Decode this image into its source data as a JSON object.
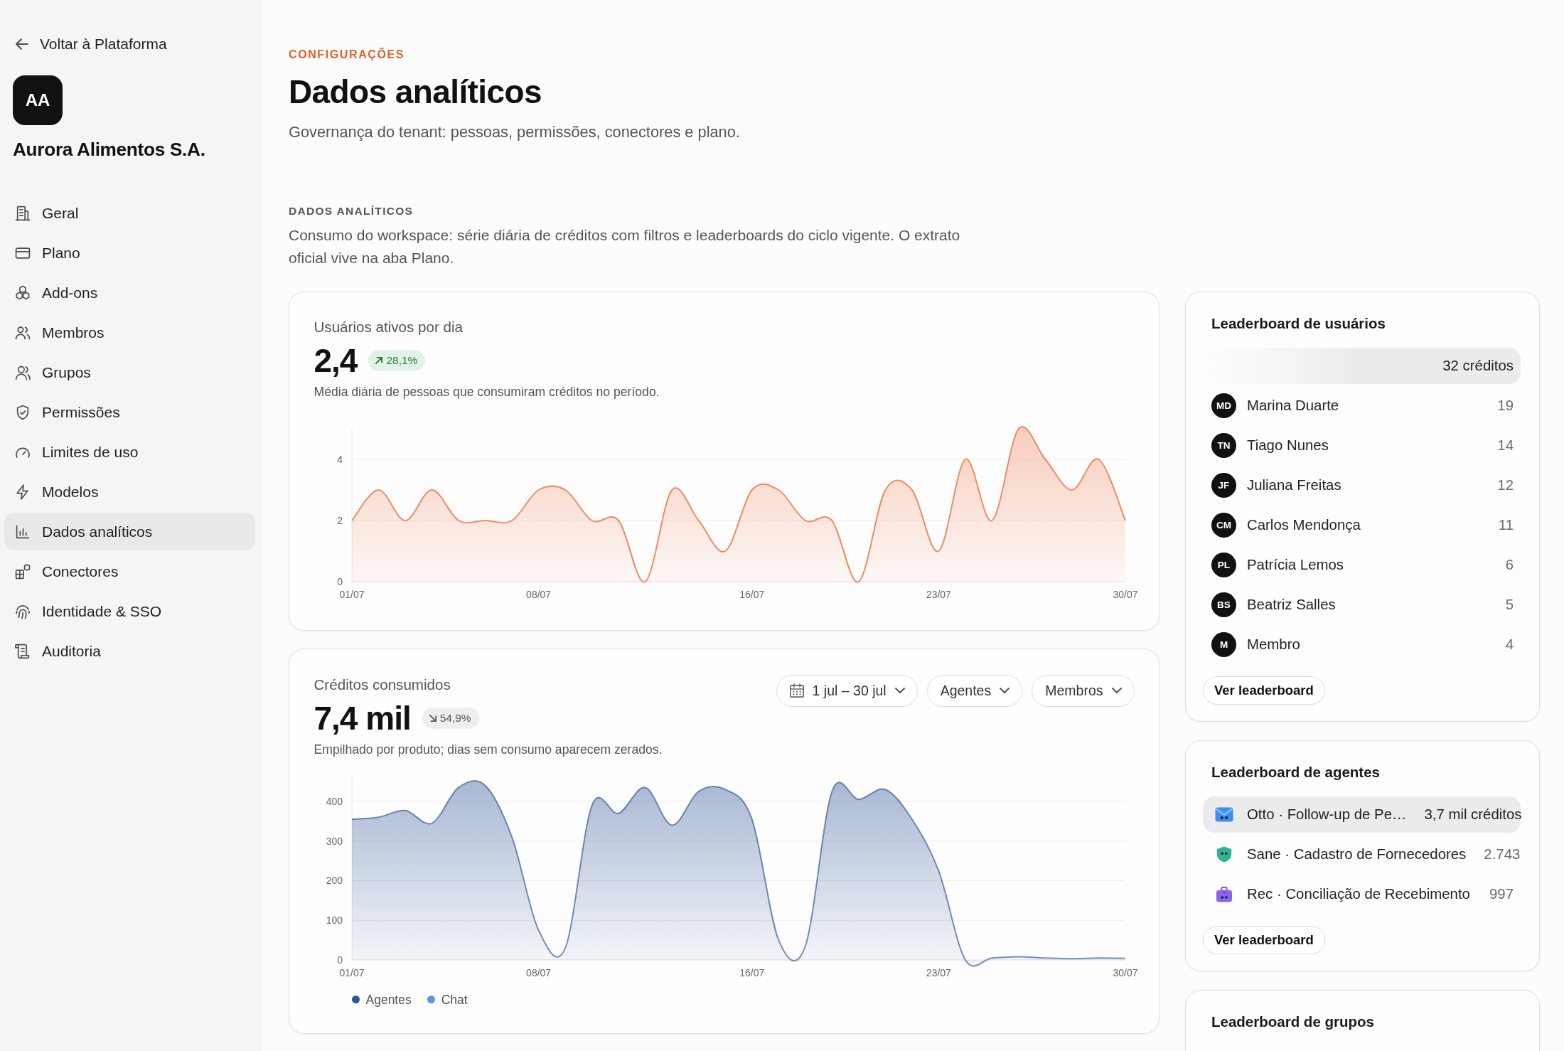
{
  "sidebar": {
    "back_link": "Voltar à Plataforma",
    "org": {
      "initials": "AA",
      "name": "Aurora Alimentos S.A."
    },
    "items": [
      {
        "label": "Geral",
        "kind": "building",
        "selected": false
      },
      {
        "label": "Plano",
        "kind": "card",
        "selected": false
      },
      {
        "label": "Add-ons",
        "kind": "cubes",
        "selected": false
      },
      {
        "label": "Membros",
        "kind": "people",
        "selected": false
      },
      {
        "label": "Grupos",
        "kind": "group",
        "selected": false
      },
      {
        "label": "Permissões",
        "kind": "shield",
        "selected": false
      },
      {
        "label": "Limites de uso",
        "kind": "gauge",
        "selected": false
      },
      {
        "label": "Modelos",
        "kind": "bolt",
        "selected": false
      },
      {
        "label": "Dados analíticos",
        "kind": "chart",
        "selected": true
      },
      {
        "label": "Conectores",
        "kind": "blocks",
        "selected": false
      },
      {
        "label": "Identidade & SSO",
        "kind": "fingerprint",
        "selected": false
      },
      {
        "label": "Auditoria",
        "kind": "scroll",
        "selected": false
      }
    ]
  },
  "header": {
    "eyebrow": "CONFIGURAÇÕES",
    "title": "Dados analíticos",
    "subtitle": "Governança do tenant: pessoas, permissões, conectores e plano."
  },
  "section": {
    "heading": "DADOS ANALÍTICOS",
    "description": "Consumo do workspace: série diária de créditos com filtros e leaderboards do ciclo vigente. O extrato oficial vive na aba Plano."
  },
  "metric_cards": [
    {
      "title": "Usuários ativos por dia",
      "value": "2,4",
      "change": {
        "kind": "up",
        "text": "28,1%"
      },
      "caption": "Média diária de pessoas que consumiram créditos no período.",
      "chart_data": {
        "type": "area",
        "grid": true,
        "categories": [
          "01/07",
          null,
          null,
          null,
          null,
          null,
          null,
          "08/07",
          null,
          null,
          null,
          null,
          null,
          null,
          null,
          "16/07",
          null,
          null,
          null,
          null,
          null,
          null,
          "23/07",
          null,
          null,
          null,
          null,
          null,
          null,
          "30/07"
        ],
        "values": [
          2,
          3,
          2,
          3,
          2,
          2,
          2,
          3,
          3,
          2,
          2,
          0,
          3,
          2,
          1,
          3,
          3,
          2,
          2,
          0,
          3,
          3,
          1,
          4,
          2,
          5,
          4,
          3,
          4,
          2
        ],
        "ylim": [
          0,
          5
        ],
        "yticks": [
          {
            "value": 0,
            "label": "0"
          },
          {
            "value": 2,
            "label": "2"
          },
          {
            "value": 4,
            "label": "4"
          }
        ]
      }
    },
    {
      "title": "Créditos consumidos",
      "value": "7,4 mil",
      "change": {
        "kind": "down",
        "text": "54,9%"
      },
      "caption": "Empilhado por produto; dias sem consumo aparecem zerados.",
      "filters": [
        {
          "kind": "date",
          "label": "1 jul – 30 jul"
        },
        {
          "kind": "select",
          "label": "Agentes"
        },
        {
          "kind": "select",
          "label": "Membros"
        }
      ],
      "chart_data": {
        "type": "area",
        "grid": true,
        "categories": [
          "01/07",
          null,
          null,
          null,
          null,
          null,
          null,
          "08/07",
          null,
          null,
          null,
          null,
          null,
          null,
          null,
          "16/07",
          null,
          null,
          null,
          null,
          null,
          null,
          "23/07",
          null,
          null,
          null,
          null,
          null,
          null,
          "30/07"
        ],
        "series": [
          {
            "name": "Agentes",
            "color": "#2f5597",
            "values": [
              355,
              360,
              377,
              345,
              435,
              440,
              310,
              75,
              30,
              390,
              370,
              435,
              340,
              425,
              430,
              355,
              50,
              35,
              425,
              405,
              430,
              355,
              225,
              0,
              5,
              8,
              5,
              3,
              5,
              4
            ]
          },
          {
            "name": "Chat",
            "color": "#5b95e0",
            "values": [
              null,
              null,
              null,
              null,
              null,
              null,
              null,
              null,
              null,
              null,
              null,
              null,
              null,
              null,
              null,
              null,
              null,
              null,
              null,
              null,
              null,
              null,
              null,
              null,
              null,
              null,
              null,
              null,
              null,
              null
            ]
          }
        ],
        "ylim": [
          0,
          460
        ],
        "yticks": [
          {
            "value": 0,
            "label": "0"
          },
          {
            "value": 100,
            "label": "100"
          },
          {
            "value": 200,
            "label": "200"
          },
          {
            "value": 300,
            "label": "300"
          },
          {
            "value": 400,
            "label": "400"
          }
        ]
      }
    }
  ],
  "leaderboards": [
    {
      "title": "Leaderboard de usuários",
      "rows": [
        {
          "value": "32 créditos",
          "highlighted": true
        },
        {
          "initials": "MD",
          "name": "Marina Duarte",
          "value": "19",
          "highlighted": false
        },
        {
          "initials": "TN",
          "name": "Tiago Nunes",
          "value": "14",
          "highlighted": false
        },
        {
          "initials": "JF",
          "name": "Juliana Freitas",
          "value": "12",
          "highlighted": false
        },
        {
          "initials": "CM",
          "name": "Carlos Mendonça",
          "value": "11",
          "highlighted": false
        },
        {
          "initials": "PL",
          "name": "Patrícia Lemos",
          "value": "6",
          "highlighted": false
        },
        {
          "initials": "BS",
          "name": "Beatriz Salles",
          "value": "5",
          "highlighted": false
        },
        {
          "initials": "M",
          "name": "Membro",
          "value": "4",
          "highlighted": false
        }
      ],
      "button": "Ver leaderboard"
    },
    {
      "title": "Leaderboard de agentes",
      "rows": [
        {
          "kind": "envelope",
          "name": "Otto · Follow-up de Pe…",
          "value": "3,7 mil créditos",
          "highlighted": true
        },
        {
          "kind": "shield",
          "name": "Sane · Cadastro de Fornecedores",
          "value": "2.743",
          "highlighted": false
        },
        {
          "kind": "briefcase",
          "name": "Rec · Conciliação de Recebimento",
          "value": "997",
          "highlighted": false
        }
      ],
      "button": "Ver leaderboard"
    },
    {
      "title": "Leaderboard de grupos"
    }
  ]
}
